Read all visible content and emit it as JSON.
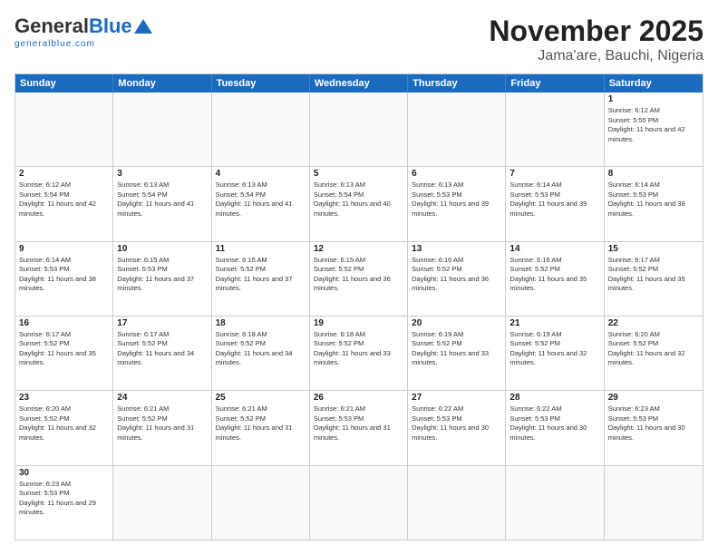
{
  "logo": {
    "general": "General",
    "blue": "Blue",
    "sub": "generalblue.com"
  },
  "title": "November 2025",
  "subtitle": "Jama'are, Bauchi, Nigeria",
  "headers": [
    "Sunday",
    "Monday",
    "Tuesday",
    "Wednesday",
    "Thursday",
    "Friday",
    "Saturday"
  ],
  "weeks": [
    [
      {
        "day": "",
        "info": ""
      },
      {
        "day": "",
        "info": ""
      },
      {
        "day": "",
        "info": ""
      },
      {
        "day": "",
        "info": ""
      },
      {
        "day": "",
        "info": ""
      },
      {
        "day": "",
        "info": ""
      },
      {
        "day": "1",
        "info": "Sunrise: 6:12 AM\nSunset: 5:55 PM\nDaylight: 11 hours and 42 minutes."
      }
    ],
    [
      {
        "day": "2",
        "info": "Sunrise: 6:12 AM\nSunset: 5:54 PM\nDaylight: 11 hours and 42 minutes."
      },
      {
        "day": "3",
        "info": "Sunrise: 6:13 AM\nSunset: 5:54 PM\nDaylight: 11 hours and 41 minutes."
      },
      {
        "day": "4",
        "info": "Sunrise: 6:13 AM\nSunset: 5:54 PM\nDaylight: 11 hours and 41 minutes."
      },
      {
        "day": "5",
        "info": "Sunrise: 6:13 AM\nSunset: 5:54 PM\nDaylight: 11 hours and 40 minutes."
      },
      {
        "day": "6",
        "info": "Sunrise: 6:13 AM\nSunset: 5:53 PM\nDaylight: 11 hours and 39 minutes."
      },
      {
        "day": "7",
        "info": "Sunrise: 6:14 AM\nSunset: 5:53 PM\nDaylight: 11 hours and 39 minutes."
      },
      {
        "day": "8",
        "info": "Sunrise: 6:14 AM\nSunset: 5:53 PM\nDaylight: 11 hours and 38 minutes."
      }
    ],
    [
      {
        "day": "9",
        "info": "Sunrise: 6:14 AM\nSunset: 5:53 PM\nDaylight: 11 hours and 38 minutes."
      },
      {
        "day": "10",
        "info": "Sunrise: 6:15 AM\nSunset: 5:53 PM\nDaylight: 11 hours and 37 minutes."
      },
      {
        "day": "11",
        "info": "Sunrise: 6:15 AM\nSunset: 5:52 PM\nDaylight: 11 hours and 37 minutes."
      },
      {
        "day": "12",
        "info": "Sunrise: 6:15 AM\nSunset: 5:52 PM\nDaylight: 11 hours and 36 minutes."
      },
      {
        "day": "13",
        "info": "Sunrise: 6:16 AM\nSunset: 5:52 PM\nDaylight: 11 hours and 36 minutes."
      },
      {
        "day": "14",
        "info": "Sunrise: 6:16 AM\nSunset: 5:52 PM\nDaylight: 11 hours and 35 minutes."
      },
      {
        "day": "15",
        "info": "Sunrise: 6:17 AM\nSunset: 5:52 PM\nDaylight: 11 hours and 35 minutes."
      }
    ],
    [
      {
        "day": "16",
        "info": "Sunrise: 6:17 AM\nSunset: 5:52 PM\nDaylight: 11 hours and 35 minutes."
      },
      {
        "day": "17",
        "info": "Sunrise: 6:17 AM\nSunset: 5:52 PM\nDaylight: 11 hours and 34 minutes."
      },
      {
        "day": "18",
        "info": "Sunrise: 6:18 AM\nSunset: 5:52 PM\nDaylight: 11 hours and 34 minutes."
      },
      {
        "day": "19",
        "info": "Sunrise: 6:18 AM\nSunset: 5:52 PM\nDaylight: 11 hours and 33 minutes."
      },
      {
        "day": "20",
        "info": "Sunrise: 6:19 AM\nSunset: 5:52 PM\nDaylight: 11 hours and 33 minutes."
      },
      {
        "day": "21",
        "info": "Sunrise: 6:19 AM\nSunset: 5:52 PM\nDaylight: 11 hours and 32 minutes."
      },
      {
        "day": "22",
        "info": "Sunrise: 6:20 AM\nSunset: 5:52 PM\nDaylight: 11 hours and 32 minutes."
      }
    ],
    [
      {
        "day": "23",
        "info": "Sunrise: 6:20 AM\nSunset: 5:52 PM\nDaylight: 11 hours and 32 minutes."
      },
      {
        "day": "24",
        "info": "Sunrise: 6:21 AM\nSunset: 5:52 PM\nDaylight: 11 hours and 31 minutes."
      },
      {
        "day": "25",
        "info": "Sunrise: 6:21 AM\nSunset: 5:52 PM\nDaylight: 11 hours and 31 minutes."
      },
      {
        "day": "26",
        "info": "Sunrise: 6:21 AM\nSunset: 5:53 PM\nDaylight: 11 hours and 31 minutes."
      },
      {
        "day": "27",
        "info": "Sunrise: 6:22 AM\nSunset: 5:53 PM\nDaylight: 11 hours and 30 minutes."
      },
      {
        "day": "28",
        "info": "Sunrise: 6:22 AM\nSunset: 5:53 PM\nDaylight: 11 hours and 30 minutes."
      },
      {
        "day": "29",
        "info": "Sunrise: 6:23 AM\nSunset: 5:53 PM\nDaylight: 11 hours and 30 minutes."
      }
    ],
    [
      {
        "day": "30",
        "info": "Sunrise: 6:23 AM\nSunset: 5:53 PM\nDaylight: 11 hours and 29 minutes."
      },
      {
        "day": "",
        "info": ""
      },
      {
        "day": "",
        "info": ""
      },
      {
        "day": "",
        "info": ""
      },
      {
        "day": "",
        "info": ""
      },
      {
        "day": "",
        "info": ""
      },
      {
        "day": "",
        "info": ""
      }
    ]
  ]
}
